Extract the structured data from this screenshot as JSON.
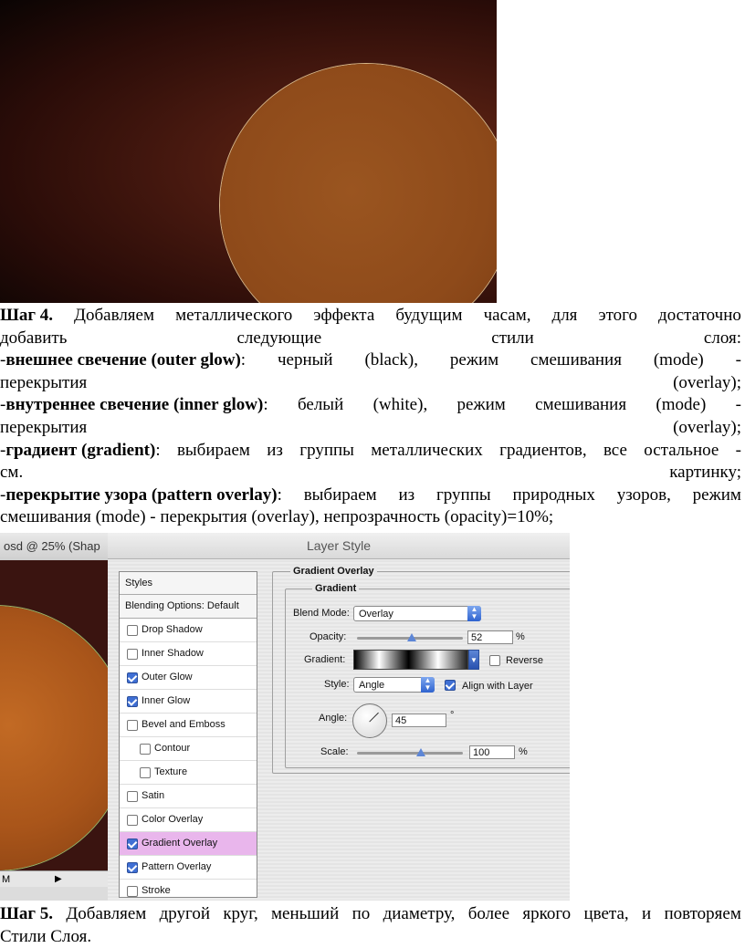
{
  "step4": {
    "label": "Шаг 4.",
    "line1": [
      "Добавляем",
      "металлического",
      "эффекта",
      "будущим",
      "часам,",
      "для",
      "этого",
      "достаточно"
    ],
    "line2": [
      "добавить",
      "следующие",
      "стили",
      "слоя:"
    ],
    "item1": {
      "dash": "-",
      "bold": "внешнее свечение (outer glow)",
      "rest": [
        "черный",
        "(black),",
        "режим",
        "смешивания",
        "(mode)",
        "-"
      ],
      "cont": [
        "перекрытия",
        "(overlay);"
      ]
    },
    "item2": {
      "dash": "-",
      "bold": "внутреннее свечение (inner glow)",
      "rest": [
        "белый",
        "(white),",
        "режим",
        "смешивания",
        "(mode)",
        "-"
      ],
      "cont": [
        "перекрытия",
        "(overlay);"
      ]
    },
    "item3": {
      "dash": "-",
      "bold": "градиент (gradient)",
      "rest": [
        "выбираем",
        "из",
        "группы",
        "металлических",
        "градиентов,",
        "все",
        "остальное",
        "-"
      ],
      "cont": [
        "см.",
        "картинку;"
      ]
    },
    "item4": {
      "dash": "-",
      "bold": "перекрытие узора (pattern overlay)",
      "rest": [
        "выбираем",
        "из",
        "группы",
        "природных",
        "узоров,",
        "режим"
      ],
      "cont": "смешивания (mode) - перекрытия (overlay), непрозрачность (opacity)=10%;"
    }
  },
  "doc_title": "osd @ 25% (Shap",
  "status_zoom": "M",
  "layer_style": {
    "title": "Layer Style",
    "styles_header": "Styles",
    "blending_options": "Blending Options: Default",
    "items": [
      {
        "label": "Drop Shadow",
        "checked": false
      },
      {
        "label": "Inner Shadow",
        "checked": false
      },
      {
        "label": "Outer Glow",
        "checked": true
      },
      {
        "label": "Inner Glow",
        "checked": true
      },
      {
        "label": "Bevel and Emboss",
        "checked": false
      },
      {
        "label": "Contour",
        "checked": false
      },
      {
        "label": "Texture",
        "checked": false
      },
      {
        "label": "Satin",
        "checked": false
      },
      {
        "label": "Color Overlay",
        "checked": false
      },
      {
        "label": "Gradient Overlay",
        "checked": true
      },
      {
        "label": "Pattern Overlay",
        "checked": true
      },
      {
        "label": "Stroke",
        "checked": false
      }
    ],
    "group_title": "Gradient Overlay",
    "subgroup_title": "Gradient",
    "blend_mode_label": "Blend Mode:",
    "blend_mode_value": "Overlay",
    "opacity_label": "Opacity:",
    "opacity_value": "52",
    "percent": "%",
    "gradient_label": "Gradient:",
    "reverse_label": "Reverse",
    "reverse_checked": false,
    "style_label": "Style:",
    "style_value": "Angle",
    "align_label": "Align with Layer",
    "align_checked": true,
    "angle_label": "Angle:",
    "angle_value": "45",
    "degree": "°",
    "scale_label": "Scale:",
    "scale_value": "100"
  },
  "step5": {
    "label": "Шаг 5.",
    "line1": [
      "Добавляем",
      "другой",
      "круг,",
      "меньший",
      "по",
      "диаметру,",
      "более",
      "яркого",
      "цвета,",
      "и",
      "повторяем"
    ],
    "line2": "Стили Слоя."
  }
}
